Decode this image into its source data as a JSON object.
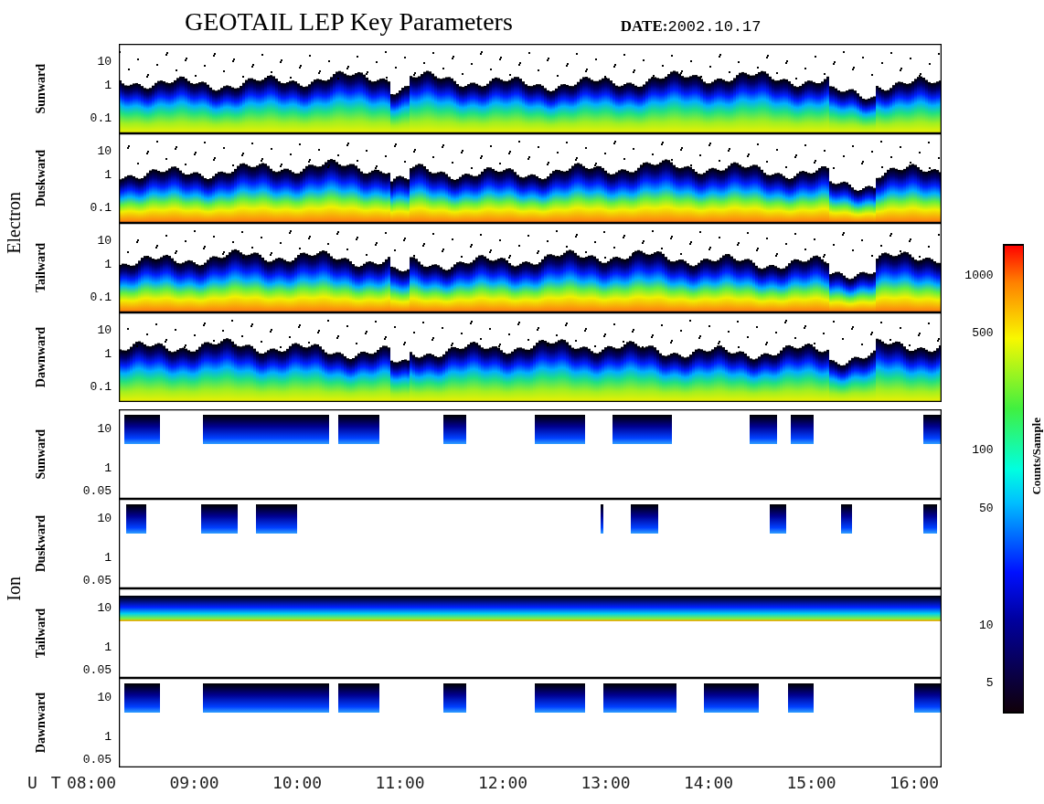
{
  "title": "GEOTAIL LEP Key Parameters",
  "date_label": "DATE:",
  "date": "2002.10.17",
  "groups": [
    {
      "name": "Electron",
      "kind": "electron",
      "panels": [
        {
          "label": "Sunward",
          "ticks": [
            "10",
            "1",
            "0.1"
          ]
        },
        {
          "label": "Duskward",
          "ticks": [
            "10",
            "1",
            "0.1"
          ]
        },
        {
          "label": "Tailward",
          "ticks": [
            "10",
            "1",
            "0.1"
          ]
        },
        {
          "label": "Dawnward",
          "ticks": [
            "10",
            "1",
            "0.1"
          ]
        }
      ]
    },
    {
      "name": "Ion",
      "kind": "ion",
      "panels": [
        {
          "label": "Sunward",
          "ticks": [
            "10",
            "1",
            "0.05"
          ]
        },
        {
          "label": "Duskward",
          "ticks": [
            "10",
            "1",
            "0.05"
          ]
        },
        {
          "label": "Tailward",
          "ticks": [
            "10",
            "1",
            "0.05"
          ]
        },
        {
          "label": "Dawnward",
          "ticks": [
            "10",
            "1",
            "0.05"
          ]
        }
      ]
    }
  ],
  "time_axis": {
    "label": "U T",
    "ticks": [
      "08:00",
      "09:00",
      "10:00",
      "11:00",
      "12:00",
      "13:00",
      "14:00",
      "15:00",
      "16:00"
    ]
  },
  "colorbar": {
    "title": "Counts/Sample",
    "ticks": [
      "1000",
      "500",
      "100",
      "50",
      "10",
      "5"
    ]
  }
}
